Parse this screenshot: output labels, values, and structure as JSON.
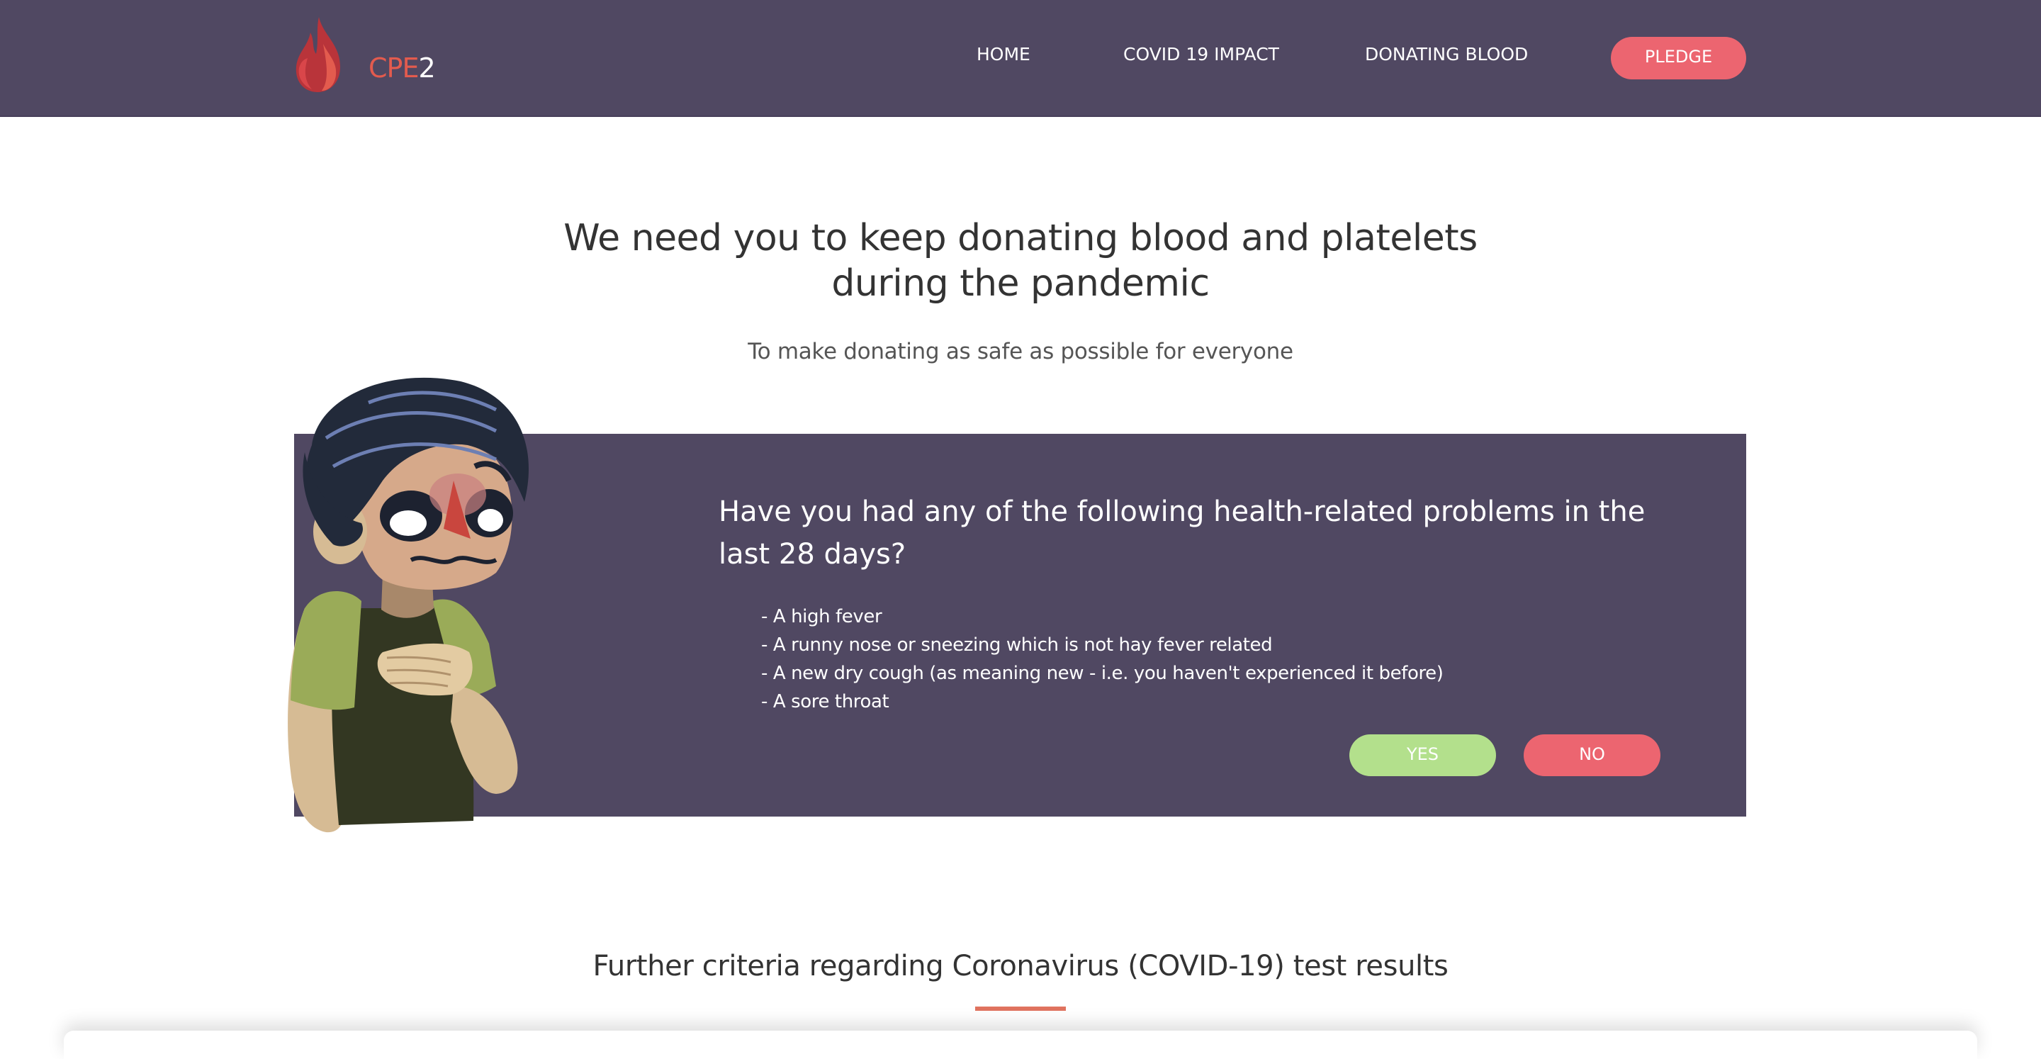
{
  "brand": {
    "name_prefix": "CPE",
    "name_suffix": "2",
    "colors": {
      "navbar": "#504862",
      "accent_red": "#ec6570",
      "accent_green": "#b3e08c",
      "underline": "#e0735f"
    }
  },
  "nav": {
    "links": [
      "HOME",
      "COVID 19 IMPACT",
      "DONATING BLOOD"
    ],
    "cta_label": "PLEDGE"
  },
  "hero": {
    "title_line1": "We need you to keep donating blood and platelets",
    "title_line2": "during the pandemic",
    "subtitle": "To make donating as safe as possible for everyone"
  },
  "question": {
    "title": "Have you had any of the following health-related problems in the last 28 days?",
    "items": [
      "- A high fever",
      "- A runny nose or sneezing which is not hay fever related",
      "- A new dry cough (as meaning new - i.e. you haven't experienced it before)",
      "- A sore throat"
    ],
    "yes_label": "YES",
    "no_label": "NO"
  },
  "criteria": {
    "title": "Further criteria regarding Coronavirus (COVID-19) test results"
  }
}
